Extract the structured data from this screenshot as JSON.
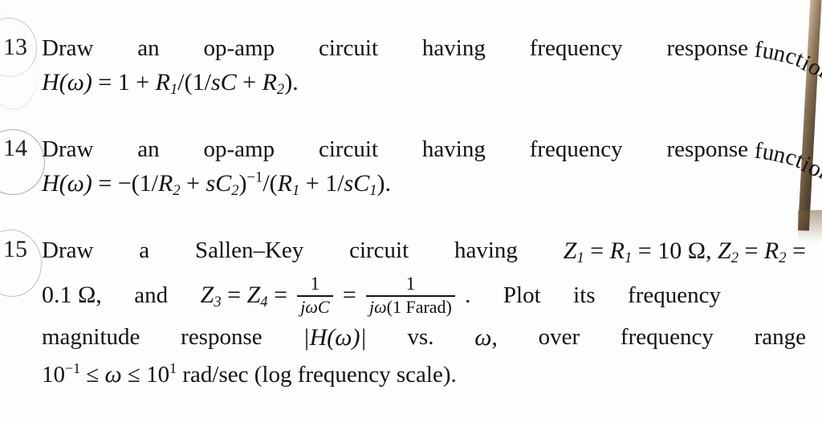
{
  "document": {
    "type": "scanned-textbook-exercise-page",
    "page_edge_color": "#6d5434",
    "pencil_annotation_color": "#b0a9b3"
  },
  "problems": [
    {
      "number": "13",
      "line1_words": [
        "Draw",
        "an",
        "op-amp",
        "circuit",
        "having",
        "frequency",
        "response"
      ],
      "line1_curved_word": "function",
      "equation": {
        "lhs": "H(ω)",
        "eq": "=",
        "rhs_parts": [
          "1",
          "+",
          "R",
          "1",
          "/(1/",
          "sC",
          "+",
          "R",
          "2",
          ")."
        ],
        "full": "H(ω) = 1 + R₁/(1/sC + R₂)."
      }
    },
    {
      "number": "14",
      "line1_words": [
        "Draw",
        "an",
        "op-amp",
        "circuit",
        "having",
        "frequency",
        "response"
      ],
      "line1_curved_word": "function",
      "equation": {
        "lhs": "H(ω)",
        "eq": "=",
        "full": "H(ω) = −(1/R₂ + sC₂)⁻¹/(R₁ + 1/sC₁)."
      }
    },
    {
      "number": "15",
      "line1_words": [
        "Draw",
        "a",
        "Sallen–Key",
        "circuit",
        "having"
      ],
      "line1_math": "Z₁ = R₁ = 10 Ω, Z₂ = R₂ =",
      "line2_prefix": "0.1 Ω,",
      "line2_and": "and",
      "line2_math": "Z₃ = Z₄ =",
      "frac1": {
        "numerator": "1",
        "denominator": "jωC"
      },
      "frac2": {
        "numerator": "1",
        "denominator_math": "jω",
        "denominator_upright": "(1 Farad)"
      },
      "line2_tail_words": [
        "Plot",
        "its",
        "frequency"
      ],
      "line3_words": [
        "magnitude",
        "response"
      ],
      "line3_math": "|H(ω)|",
      "line3_tail_words": [
        "vs.",
        "ω,",
        "over",
        "frequency",
        "range"
      ],
      "line4_text": "10⁻¹ ≤ ω ≤ 10¹ rad/sec (log frequency scale)."
    }
  ],
  "symbols": {
    "omega": "ω",
    "ohm": "Ω",
    "leq": "≤",
    "minus": "−",
    "endash": "–"
  }
}
